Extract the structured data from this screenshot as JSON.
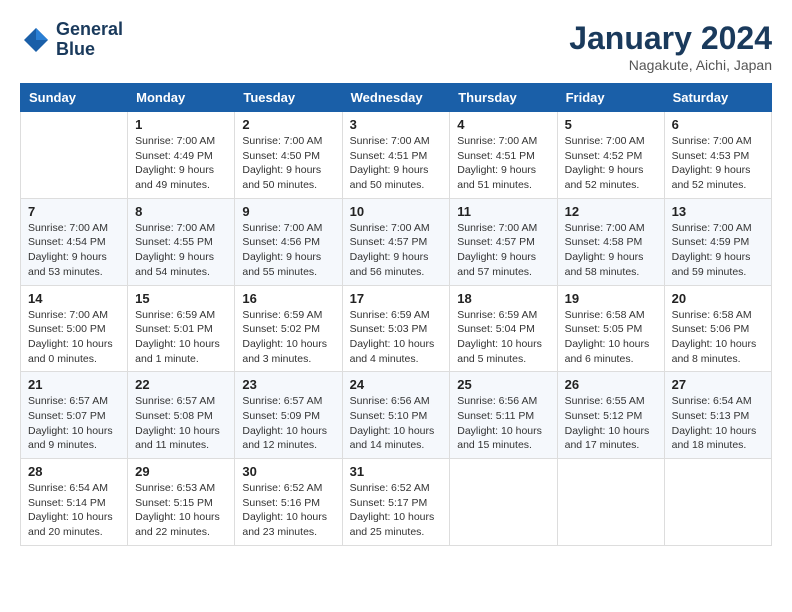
{
  "header": {
    "logo_line1": "General",
    "logo_line2": "Blue",
    "month_year": "January 2024",
    "location": "Nagakute, Aichi, Japan"
  },
  "columns": [
    "Sunday",
    "Monday",
    "Tuesday",
    "Wednesday",
    "Thursday",
    "Friday",
    "Saturday"
  ],
  "weeks": [
    [
      {
        "day": "",
        "info": ""
      },
      {
        "day": "1",
        "info": "Sunrise: 7:00 AM\nSunset: 4:49 PM\nDaylight: 9 hours\nand 49 minutes."
      },
      {
        "day": "2",
        "info": "Sunrise: 7:00 AM\nSunset: 4:50 PM\nDaylight: 9 hours\nand 50 minutes."
      },
      {
        "day": "3",
        "info": "Sunrise: 7:00 AM\nSunset: 4:51 PM\nDaylight: 9 hours\nand 50 minutes."
      },
      {
        "day": "4",
        "info": "Sunrise: 7:00 AM\nSunset: 4:51 PM\nDaylight: 9 hours\nand 51 minutes."
      },
      {
        "day": "5",
        "info": "Sunrise: 7:00 AM\nSunset: 4:52 PM\nDaylight: 9 hours\nand 52 minutes."
      },
      {
        "day": "6",
        "info": "Sunrise: 7:00 AM\nSunset: 4:53 PM\nDaylight: 9 hours\nand 52 minutes."
      }
    ],
    [
      {
        "day": "7",
        "info": "Sunrise: 7:00 AM\nSunset: 4:54 PM\nDaylight: 9 hours\nand 53 minutes."
      },
      {
        "day": "8",
        "info": "Sunrise: 7:00 AM\nSunset: 4:55 PM\nDaylight: 9 hours\nand 54 minutes."
      },
      {
        "day": "9",
        "info": "Sunrise: 7:00 AM\nSunset: 4:56 PM\nDaylight: 9 hours\nand 55 minutes."
      },
      {
        "day": "10",
        "info": "Sunrise: 7:00 AM\nSunset: 4:57 PM\nDaylight: 9 hours\nand 56 minutes."
      },
      {
        "day": "11",
        "info": "Sunrise: 7:00 AM\nSunset: 4:57 PM\nDaylight: 9 hours\nand 57 minutes."
      },
      {
        "day": "12",
        "info": "Sunrise: 7:00 AM\nSunset: 4:58 PM\nDaylight: 9 hours\nand 58 minutes."
      },
      {
        "day": "13",
        "info": "Sunrise: 7:00 AM\nSunset: 4:59 PM\nDaylight: 9 hours\nand 59 minutes."
      }
    ],
    [
      {
        "day": "14",
        "info": "Sunrise: 7:00 AM\nSunset: 5:00 PM\nDaylight: 10 hours\nand 0 minutes."
      },
      {
        "day": "15",
        "info": "Sunrise: 6:59 AM\nSunset: 5:01 PM\nDaylight: 10 hours\nand 1 minute."
      },
      {
        "day": "16",
        "info": "Sunrise: 6:59 AM\nSunset: 5:02 PM\nDaylight: 10 hours\nand 3 minutes."
      },
      {
        "day": "17",
        "info": "Sunrise: 6:59 AM\nSunset: 5:03 PM\nDaylight: 10 hours\nand 4 minutes."
      },
      {
        "day": "18",
        "info": "Sunrise: 6:59 AM\nSunset: 5:04 PM\nDaylight: 10 hours\nand 5 minutes."
      },
      {
        "day": "19",
        "info": "Sunrise: 6:58 AM\nSunset: 5:05 PM\nDaylight: 10 hours\nand 6 minutes."
      },
      {
        "day": "20",
        "info": "Sunrise: 6:58 AM\nSunset: 5:06 PM\nDaylight: 10 hours\nand 8 minutes."
      }
    ],
    [
      {
        "day": "21",
        "info": "Sunrise: 6:57 AM\nSunset: 5:07 PM\nDaylight: 10 hours\nand 9 minutes."
      },
      {
        "day": "22",
        "info": "Sunrise: 6:57 AM\nSunset: 5:08 PM\nDaylight: 10 hours\nand 11 minutes."
      },
      {
        "day": "23",
        "info": "Sunrise: 6:57 AM\nSunset: 5:09 PM\nDaylight: 10 hours\nand 12 minutes."
      },
      {
        "day": "24",
        "info": "Sunrise: 6:56 AM\nSunset: 5:10 PM\nDaylight: 10 hours\nand 14 minutes."
      },
      {
        "day": "25",
        "info": "Sunrise: 6:56 AM\nSunset: 5:11 PM\nDaylight: 10 hours\nand 15 minutes."
      },
      {
        "day": "26",
        "info": "Sunrise: 6:55 AM\nSunset: 5:12 PM\nDaylight: 10 hours\nand 17 minutes."
      },
      {
        "day": "27",
        "info": "Sunrise: 6:54 AM\nSunset: 5:13 PM\nDaylight: 10 hours\nand 18 minutes."
      }
    ],
    [
      {
        "day": "28",
        "info": "Sunrise: 6:54 AM\nSunset: 5:14 PM\nDaylight: 10 hours\nand 20 minutes."
      },
      {
        "day": "29",
        "info": "Sunrise: 6:53 AM\nSunset: 5:15 PM\nDaylight: 10 hours\nand 22 minutes."
      },
      {
        "day": "30",
        "info": "Sunrise: 6:52 AM\nSunset: 5:16 PM\nDaylight: 10 hours\nand 23 minutes."
      },
      {
        "day": "31",
        "info": "Sunrise: 6:52 AM\nSunset: 5:17 PM\nDaylight: 10 hours\nand 25 minutes."
      },
      {
        "day": "",
        "info": ""
      },
      {
        "day": "",
        "info": ""
      },
      {
        "day": "",
        "info": ""
      }
    ]
  ]
}
